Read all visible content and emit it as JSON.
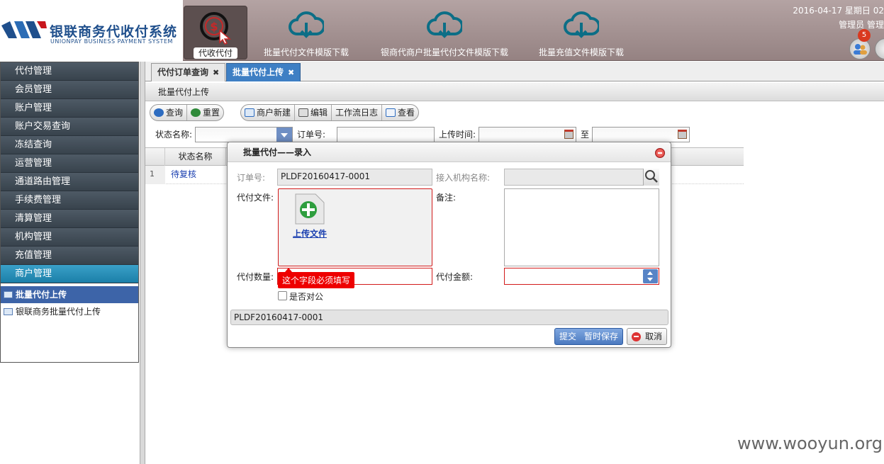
{
  "header": {
    "logo_cn": "银联商务代收付系统",
    "logo_en": "UNIONPAY BUSINESS PAYMENT SYSTEM",
    "nav": [
      {
        "label": "代收代付",
        "icon": "dollar-cursor-icon",
        "active": true
      },
      {
        "label": "批量代付文件模版下载",
        "icon": "cloud-download-icon"
      },
      {
        "label": "银商代商户批量代付文件模版下载",
        "icon": "cloud-download-icon"
      },
      {
        "label": "批量充值文件模版下载",
        "icon": "cloud-download-icon"
      }
    ],
    "datetime": "2016-04-17 星期日 02",
    "user": "管理员 管理",
    "notification_count": "5"
  },
  "sidebar": {
    "menu": [
      "代付管理",
      "会员管理",
      "账户管理",
      "账户交易查询",
      "冻结查询",
      "运营管理",
      "通道路由管理",
      "手续费管理",
      "清算管理",
      "机构管理",
      "充值管理",
      "商户管理"
    ],
    "active_menu": "商户管理",
    "submenu": [
      "批量代付上传",
      "银联商务批量代付上传"
    ]
  },
  "tabs": [
    {
      "label": "代付订单查询"
    },
    {
      "label": "批量代付上传",
      "active": true
    }
  ],
  "panel": {
    "title": "批量代付上传",
    "toolbar1": [
      "查询",
      "重置"
    ],
    "toolbar2": [
      "商户新建",
      "编辑",
      "工作流日志",
      "查看"
    ],
    "filters": {
      "status_label": "状态名称:",
      "order_label": "订单号:",
      "upload_time_label": "上传时间:",
      "to_label": "至"
    },
    "grid": {
      "columns": [
        "状态名称"
      ],
      "rows": [
        {
          "num": "1",
          "status": "待复核"
        }
      ]
    }
  },
  "modal": {
    "title": "批量代付——录入",
    "order_no_label": "订单号:",
    "order_no_value": "PLDF20160417-0001",
    "org_label": "接入机构名称:",
    "file_label": "代付文件:",
    "upload_label": "上传文件",
    "remark_label": "备注:",
    "count_label": "代付数量:",
    "amount_label": "代付金额:",
    "tooltip": "这个字段必须填写",
    "public_label": "是否对公",
    "footer_value": "PLDF20160417-0001",
    "submit": "提交",
    "save_temp": "暂时保存",
    "cancel": "取消"
  },
  "watermark": "www.wooyun.org",
  "colors": {
    "header_bg": "#a89696",
    "sidebar_menu_bg": "#3f4a55",
    "sidebar_active_bg": "#2a8fb9",
    "tab_active_bg": "#3e7fc4",
    "error_red": "#d21b1b"
  }
}
